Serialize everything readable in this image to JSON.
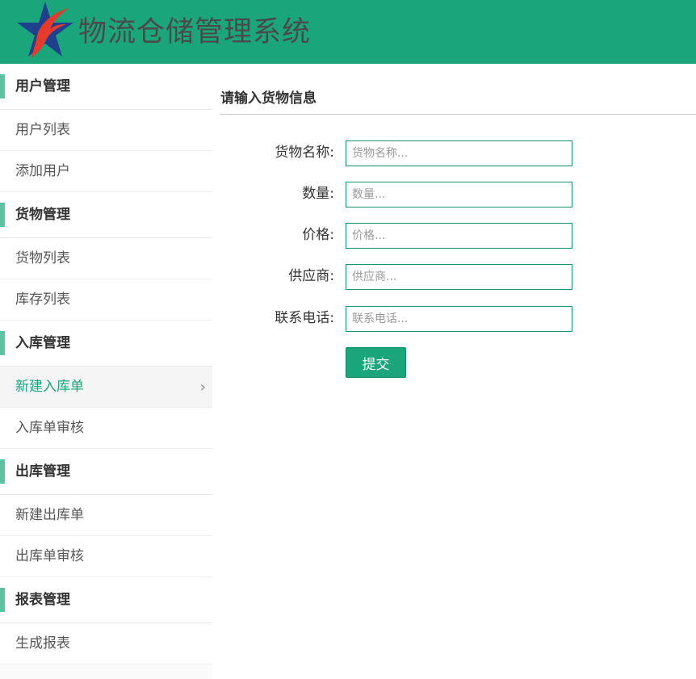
{
  "header": {
    "title": "物流仓储管理系统",
    "logo_icon": "star-flame-logo-icon",
    "bg_color": "#1aa57a"
  },
  "sidebar": {
    "groups": [
      {
        "label": "用户管理",
        "items": [
          {
            "label": "用户列表"
          },
          {
            "label": "添加用户"
          }
        ]
      },
      {
        "label": "货物管理",
        "items": [
          {
            "label": "货物列表"
          },
          {
            "label": "库存列表"
          }
        ]
      },
      {
        "label": "入库管理",
        "items": [
          {
            "label": "新建入库单",
            "active": true
          },
          {
            "label": "入库单审核"
          }
        ]
      },
      {
        "label": "出库管理",
        "items": [
          {
            "label": "新建出库单"
          },
          {
            "label": "出库单审核"
          }
        ]
      },
      {
        "label": "报表管理",
        "items": [
          {
            "label": "生成报表"
          }
        ]
      }
    ],
    "active_icon": "chevron-right-icon",
    "accent_color": "#5cc39f"
  },
  "form": {
    "title": "请输入货物信息",
    "fields": [
      {
        "label": "货物名称:",
        "placeholder": "货物名称...",
        "value": ""
      },
      {
        "label": "数量:",
        "placeholder": "数量...",
        "value": ""
      },
      {
        "label": "价格:",
        "placeholder": "价格...",
        "value": ""
      },
      {
        "label": "供应商:",
        "placeholder": "供应商...",
        "value": ""
      },
      {
        "label": "联系电话:",
        "placeholder": "联系电话...",
        "value": ""
      }
    ],
    "submit_label": "提交"
  }
}
